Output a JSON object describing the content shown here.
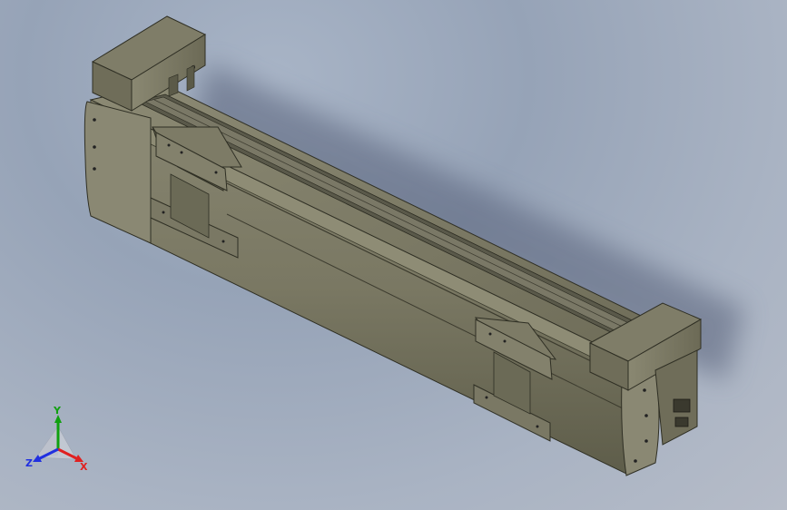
{
  "viewport": {
    "background_top": "#9aa6ba",
    "background_bottom": "#b6bcc8"
  },
  "model": {
    "body_color": "#76745f",
    "body_dark": "#54533f",
    "body_light": "#9a987f",
    "rail_color": "#5e5d4b"
  },
  "triad": {
    "x_label": "X",
    "y_label": "Y",
    "z_label": "Z",
    "x_color": "#e02020",
    "y_color": "#10a010",
    "z_color": "#2030e0"
  }
}
